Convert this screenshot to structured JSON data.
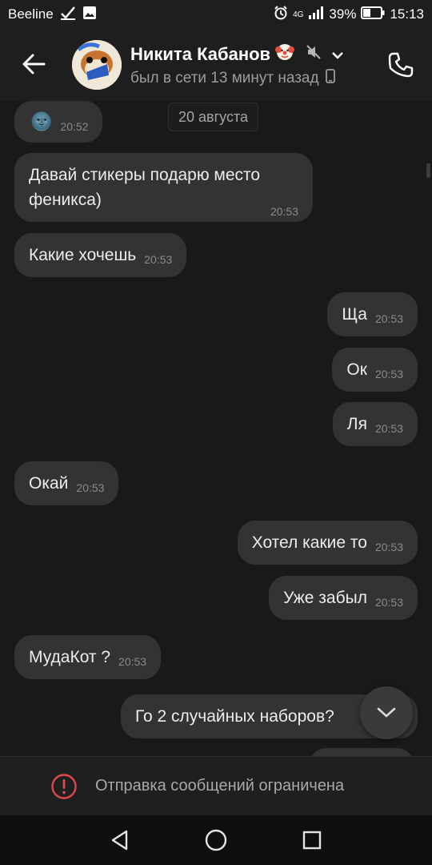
{
  "status_bar": {
    "carrier": "Beeline",
    "network": "4G",
    "battery": "39%",
    "time": "15:13"
  },
  "header": {
    "contact_name": "Никита Кабанов",
    "last_seen": "был в сети 13 минут назад"
  },
  "chat": {
    "date_separator": "20 августа",
    "messages": [
      {
        "side": "in",
        "text": "🌚",
        "time": "20:52"
      },
      {
        "side": "in",
        "text": "Давай стикеры подарю место",
        "text2": "феникса)",
        "time": "20:53"
      },
      {
        "side": "in",
        "text": "Какие хочешь",
        "time": "20:53"
      },
      {
        "side": "out",
        "text": "Ща",
        "time": "20:53"
      },
      {
        "side": "out",
        "text": "Ок",
        "time": "20:53"
      },
      {
        "side": "out",
        "text": "Ля",
        "time": "20:53"
      },
      {
        "side": "in",
        "text": "Окай",
        "time": "20:53"
      },
      {
        "side": "out",
        "text": "Хотел какие то",
        "time": "20:53"
      },
      {
        "side": "out",
        "text": "Уже забыл",
        "time": "20:53"
      },
      {
        "side": "in",
        "text": "МудаКот ?",
        "time": "20:53"
      },
      {
        "side": "out",
        "text": "Го 2 случайных наборов?",
        "time": ""
      }
    ]
  },
  "composer": {
    "restriction_text": "Отправка сообщений ограничена"
  },
  "colors": {
    "background": "#191919",
    "bubble": "#333333",
    "accent_red": "#e0484f"
  }
}
